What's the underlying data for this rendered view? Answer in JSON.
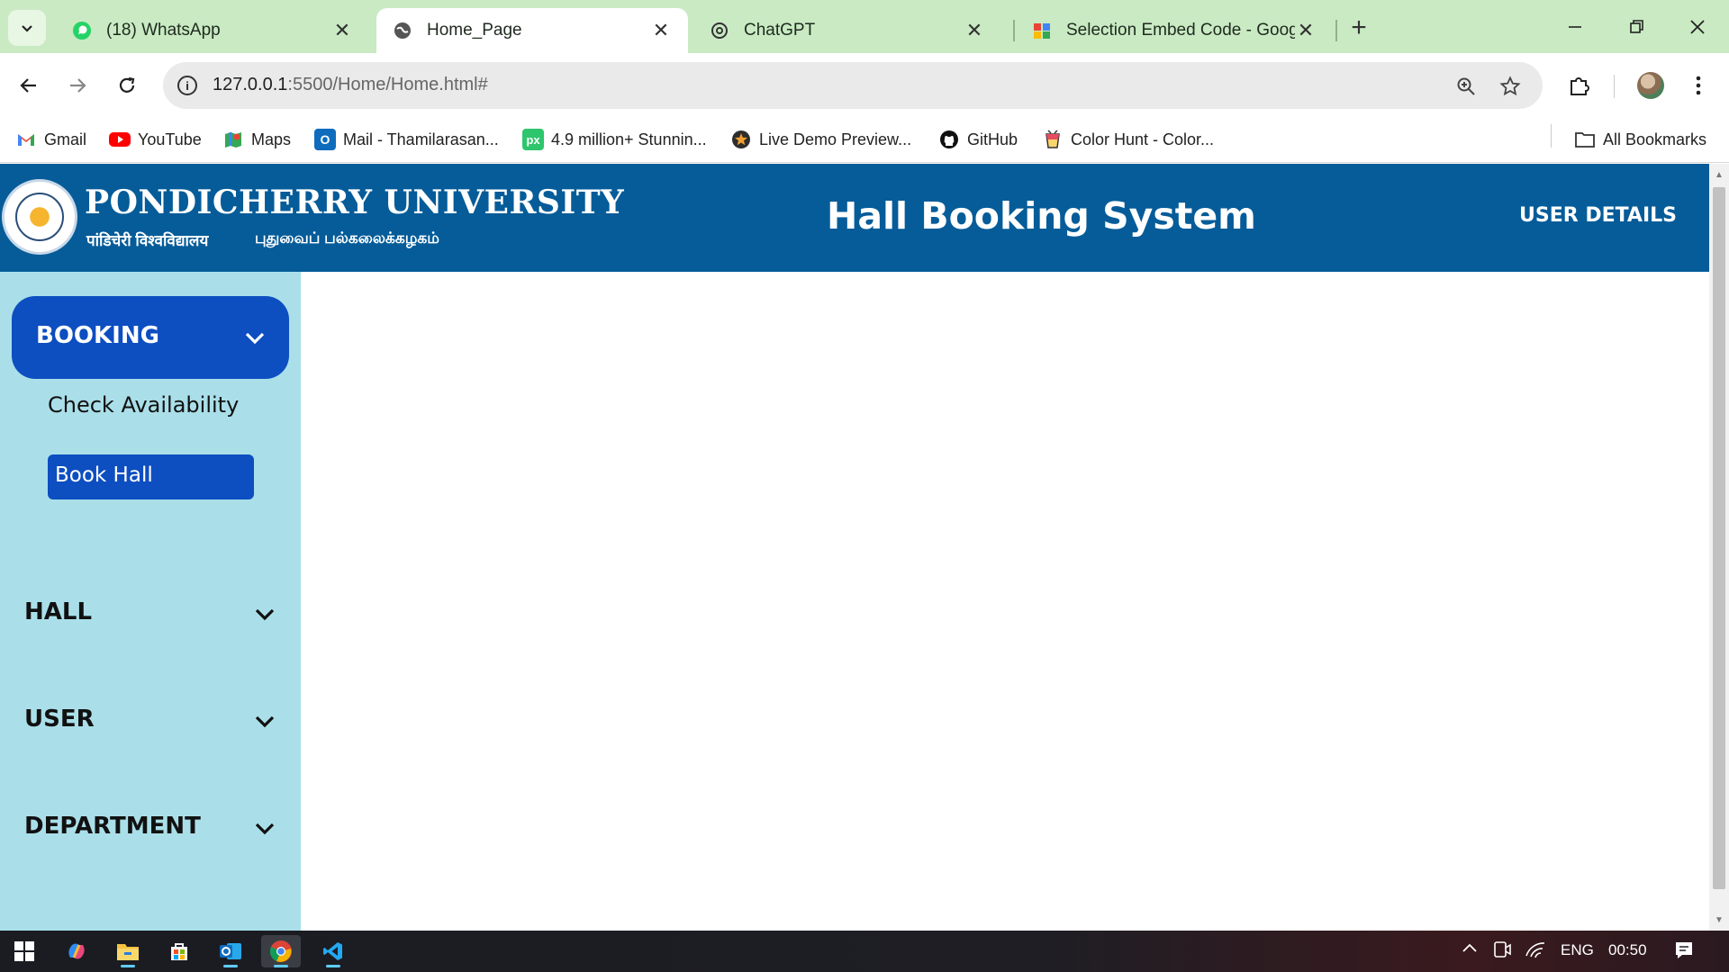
{
  "browser": {
    "tabs": [
      {
        "title": "(18) WhatsApp",
        "icon": "whatsapp-icon"
      },
      {
        "title": "Home_Page",
        "icon": "globe-icon",
        "active": true
      },
      {
        "title": "ChatGPT",
        "icon": "chatgpt-icon"
      },
      {
        "title": "Selection Embed Code - Google",
        "icon": "google-icon"
      }
    ],
    "close_glyph": "✕",
    "new_tab_glyph": "+",
    "url_host": "127.0.0.1",
    "url_path": ":5500/Home/Home.html#",
    "bookmarks": [
      {
        "label": "Gmail",
        "icon": "gmail-icon"
      },
      {
        "label": "YouTube",
        "icon": "youtube-icon"
      },
      {
        "label": "Maps",
        "icon": "maps-icon"
      },
      {
        "label": "Mail - Thamilarasan...",
        "icon": "outlook-icon"
      },
      {
        "label": "4.9 million+ Stunnin...",
        "icon": "pixabay-icon"
      },
      {
        "label": "Live Demo Preview...",
        "icon": "star-badge-icon"
      },
      {
        "label": "GitHub",
        "icon": "github-icon"
      },
      {
        "label": "Color Hunt - Color...",
        "icon": "colorhunt-icon"
      }
    ],
    "all_bookmarks": "All Bookmarks"
  },
  "header": {
    "university_name": "PONDICHERRY UNIVERSITY",
    "university_hindi": "पांडिचेरी विश्वविद्यालय",
    "university_tamil": "புதுவைப் பல்கலைக்கழகம்",
    "app_title": "Hall Booking System",
    "user_details": "USER DETAILS"
  },
  "sidebar": {
    "sections": [
      {
        "label": "BOOKING",
        "expanded": true,
        "items": [
          {
            "label": "Check Availability",
            "active": false
          },
          {
            "label": "Book Hall",
            "active": true
          }
        ]
      },
      {
        "label": "HALL",
        "expanded": false
      },
      {
        "label": "USER",
        "expanded": false
      },
      {
        "label": "DEPARTMENT",
        "expanded": false
      }
    ]
  },
  "taskbar": {
    "apps": [
      "windows-start-icon",
      "copilot-icon",
      "file-explorer-icon",
      "store-icon",
      "outlook-icon",
      "chrome-icon",
      "vscode-icon"
    ],
    "language": "ENG",
    "time": "00:50"
  },
  "colors": {
    "header_bg": "#055c99",
    "sidebar_bg": "#aadfe9",
    "active_blue": "#0d4ec1",
    "tabbar_bg": "#c9eac3"
  }
}
